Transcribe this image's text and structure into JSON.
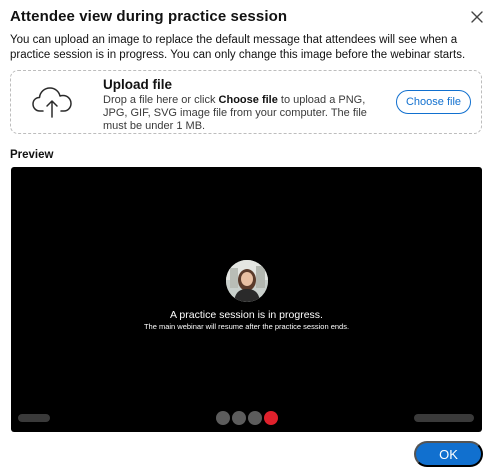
{
  "dialog": {
    "title": "Attendee view during practice session",
    "description": "You can upload an image to replace the default message that attendees will see when a practice session is in progress. You can only change this image before the webinar starts."
  },
  "upload": {
    "title": "Upload file",
    "text_before": "Drop a file here or click ",
    "text_bold": "Choose file",
    "text_after": " to upload a PNG, JPG, GIF, SVG image file from your computer. The file must be under 1 MB.",
    "button_label": "Choose file",
    "icon": "cloud-upload-icon"
  },
  "preview": {
    "label": "Preview",
    "message": "A practice session is in progress.",
    "submessage": "The main webinar will resume after the practice session ends."
  },
  "footer": {
    "ok_label": "OK"
  },
  "colors": {
    "accent": "#1170cf",
    "preview_bg": "#000000",
    "end_call": "#e0212c"
  }
}
